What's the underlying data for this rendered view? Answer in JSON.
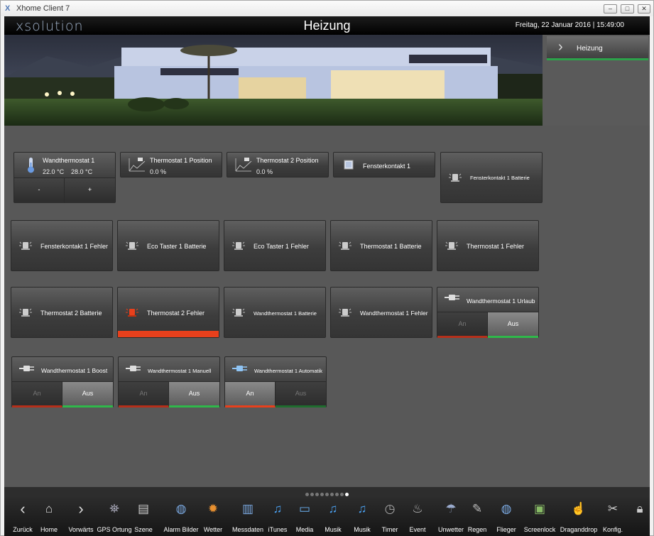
{
  "window": {
    "title": "Xhome Client 7",
    "logo": "X"
  },
  "header": {
    "brand": "xsolution",
    "title": "Heizung",
    "datetime": "Freitag, 22 Januar 2016  |  15:49:00"
  },
  "nav": {
    "label": "Heizung"
  },
  "tiles": {
    "wandthermostat1": {
      "name": "Wandthermostat 1",
      "temp1": "22.0 °C",
      "temp2": "28.0 °C",
      "minus": "-",
      "plus": "+"
    },
    "thermostat1_position": {
      "name": "Thermostat 1 Position",
      "value": "0.0 %"
    },
    "thermostat2_position": {
      "name": "Thermostat 2 Position",
      "value": "0.0 %"
    },
    "fensterkontakt1": {
      "name": "Fensterkontakt 1"
    },
    "fensterkontakt1_batterie": {
      "name": "Fensterkontakt 1 Batterie"
    },
    "fensterkontakt1_fehler": {
      "name": "Fensterkontakt 1 Fehler"
    },
    "eco_taster1_batterie": {
      "name": "Eco Taster 1 Batterie"
    },
    "eco_taster1_fehler": {
      "name": "Eco Taster 1 Fehler"
    },
    "thermostat1_batterie": {
      "name": "Thermostat 1 Batterie"
    },
    "thermostat1_fehler": {
      "name": "Thermostat 1 Fehler"
    },
    "thermostat2_batterie": {
      "name": "Thermostat 2 Batterie"
    },
    "thermostat2_fehler": {
      "name": "Thermostat 2 Fehler",
      "status_color": "#e8401c"
    },
    "wandthermostat1_batterie": {
      "name": "Wandthermostat 1 Batterie"
    },
    "wandthermostat1_fehler": {
      "name": "Wandthermostat 1 Fehler"
    },
    "wandthermostat1_urlaub": {
      "name": "Wandthermostat 1 Urlaub",
      "on": "An",
      "off": "Aus",
      "active": "Aus"
    },
    "wandthermostat1_boost": {
      "name": "Wandthermostat 1 Boost",
      "on": "An",
      "off": "Aus",
      "active": "Aus"
    },
    "wandthermostat1_manuell": {
      "name": "Wandthermostat 1 Manuell",
      "on": "An",
      "off": "Aus",
      "active": "Aus"
    },
    "wandthermostat1_automatik": {
      "name": "Wandthermostat 1 Automatik",
      "on": "An",
      "off": "Aus",
      "active": "An"
    }
  },
  "pager": {
    "pages": 9,
    "active": 9
  },
  "toolbar": [
    {
      "label": "Zurück",
      "icon": "arrow-left-icon"
    },
    {
      "label": "Home",
      "icon": "home-icon"
    },
    {
      "label": "Vorwärts",
      "icon": "arrow-right-icon"
    },
    {
      "label": "GPS Ortung",
      "icon": "satellite-icon"
    },
    {
      "label": "Szene",
      "icon": "clapperboard-icon"
    },
    {
      "label": "Alarm Bilder",
      "icon": "globe-icon"
    },
    {
      "label": "Wetter",
      "icon": "sun-icon"
    },
    {
      "label": "Messdaten",
      "icon": "bar-chart-icon"
    },
    {
      "label": "iTunes",
      "icon": "music-note-icon"
    },
    {
      "label": "Media",
      "icon": "monitor-icon"
    },
    {
      "label": "Musik",
      "icon": "music-note-icon"
    },
    {
      "label": "Musik",
      "icon": "music-note-icon"
    },
    {
      "label": "Timer",
      "icon": "clock-icon"
    },
    {
      "label": "Event",
      "icon": "siren-icon"
    },
    {
      "label": "Unwetter",
      "icon": "rain-cloud-icon"
    },
    {
      "label": "Regen",
      "icon": "pen-icon"
    },
    {
      "label": "Flieger",
      "icon": "globe-icon"
    },
    {
      "label": "Screenlock",
      "icon": "picture-icon"
    },
    {
      "label": "Draganddrop",
      "icon": "hand-pointer-icon"
    },
    {
      "label": "Konfig.",
      "icon": "tools-icon"
    },
    {
      "label": "",
      "icon": "lock-icon"
    }
  ],
  "colors": {
    "accent_green": "#2fb84a",
    "alarm_red": "#e8401c"
  }
}
